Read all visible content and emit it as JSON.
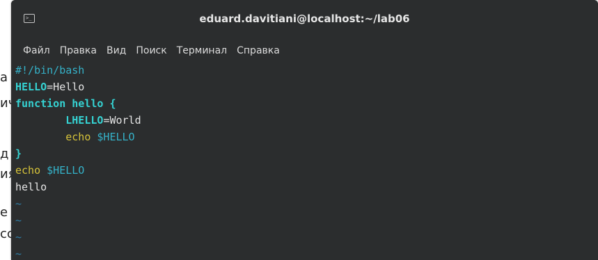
{
  "window": {
    "title": "eduard.davitiani@localhost:~/lab06"
  },
  "menu": [
    {
      "label": "Файл"
    },
    {
      "label": "Правка"
    },
    {
      "label": "Вид"
    },
    {
      "label": "Поиск"
    },
    {
      "label": "Терминал"
    },
    {
      "label": "Справка"
    }
  ],
  "editor": {
    "lines": [
      {
        "comment": "#!/bin/bash"
      },
      {
        "var": "HELLO",
        "rest": "=Hello"
      },
      {
        "kw": "function hello {"
      },
      {
        "indent": "        ",
        "var": "LHELLO",
        "rest": "=World"
      },
      {
        "indent": "        ",
        "echo": "echo",
        "space": " ",
        "ref": "$HELLO"
      },
      {
        "kw": "}"
      },
      {
        "echo": "echo",
        "space": " ",
        "ref": "$HELLO"
      },
      {
        "plain": "hello"
      }
    ],
    "tilde": "~"
  },
  "background_fragments": [
    "а",
    "ич",
    "д",
    "ия",
    "е",
    "сс"
  ]
}
